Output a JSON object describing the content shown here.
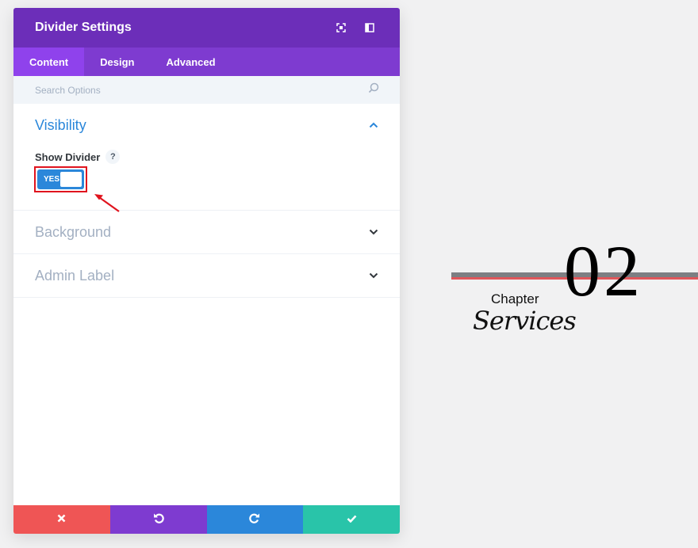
{
  "modal": {
    "title": "Divider Settings",
    "header_icons": [
      "fullscreen-icon",
      "sidebar-icon"
    ],
    "tabs": [
      {
        "label": "Content",
        "active": true
      },
      {
        "label": "Design",
        "active": false
      },
      {
        "label": "Advanced",
        "active": false
      }
    ],
    "search": {
      "placeholder": "Search Options",
      "value": ""
    },
    "sections": {
      "visibility": {
        "title": "Visibility",
        "expanded": true,
        "show_divider_label": "Show Divider",
        "help_glyph": "?",
        "toggle_label": "YES",
        "toggle_on": true
      },
      "background": {
        "title": "Background",
        "expanded": false
      },
      "admin_label": {
        "title": "Admin Label",
        "expanded": false
      }
    },
    "footer": {
      "buttons": [
        {
          "name": "close",
          "icon": "close-icon",
          "color": "#ef5555"
        },
        {
          "name": "undo",
          "icon": "undo-icon",
          "color": "#7e3bd0"
        },
        {
          "name": "redo",
          "icon": "redo-icon",
          "color": "#2b87da"
        },
        {
          "name": "save",
          "icon": "check-icon",
          "color": "#29c4a9"
        }
      ]
    }
  },
  "preview": {
    "number": "02",
    "label": "Chapter",
    "title": "Services"
  },
  "colors": {
    "header": "#6c2eb9",
    "tabs": "#7e3bd0",
    "active_tab": "#8f42ec",
    "accent_blue": "#2b87da",
    "highlight_red": "#e0141e"
  }
}
